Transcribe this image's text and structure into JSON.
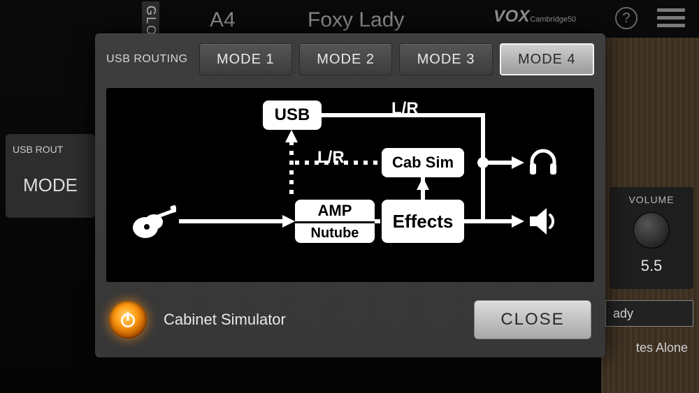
{
  "header": {
    "tag_label": "GLO",
    "slot": "A4",
    "preset_name": "Foxy Lady",
    "brand": "VOX",
    "brand_suffix": "Cambridge50",
    "help_label": "?"
  },
  "sidebar": {
    "usb_routing": {
      "label": "USB ROUT",
      "current": "MODE"
    }
  },
  "right_panel": {
    "volume": {
      "label": "VOLUME",
      "value": "5.5"
    },
    "preset_box": "ady",
    "subtext": "tes Alone"
  },
  "dialog": {
    "tabs_label": "USB ROUTING",
    "tabs": [
      "MODE 1",
      "MODE 2",
      "MODE 3",
      "MODE 4"
    ],
    "active_tab": 3,
    "diagram": {
      "usb": "USB",
      "lr1": "L/R",
      "lr2": "L/R",
      "cabsim": "Cab Sim",
      "amp": "AMP",
      "nutube": "Nutube",
      "effects": "Effects"
    },
    "cabinet_toggle_label": "Cabinet Simulator",
    "close_label": "CLOSE"
  }
}
